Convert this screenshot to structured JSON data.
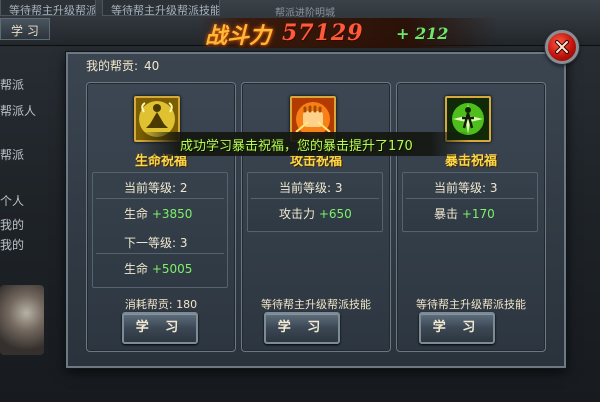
{
  "background": {
    "tabs": [
      "等待帮主升级帮派技能",
      "等待帮主升级帮派技能"
    ],
    "learn_label": "学 习",
    "top_hint": "帮派进阶明城",
    "side_lines": [
      "帮派",
      "帮派人",
      "帮派",
      "个人",
      "我的",
      "我的"
    ]
  },
  "power": {
    "label": "战斗力",
    "value": "57129",
    "delta": "+ 212"
  },
  "dialog": {
    "contribution_label": "我的帮贡:",
    "contribution_value": "40",
    "toast": "成功学习暴击祝福，您的暴击提升了170"
  },
  "skills": [
    {
      "name": "生命祝福",
      "icon": "meditation-icon",
      "current_level_label": "当前等级: 2",
      "current_stat_name": "生命",
      "current_stat_value": "+3850",
      "next_level_label": "下一等级: 3",
      "next_stat_name": "生命",
      "next_stat_value": "+5005",
      "cost_text": "消耗帮贡: 180",
      "button_label": "学 习"
    },
    {
      "name": "攻击祝福",
      "icon": "fist-icon",
      "current_level_label": "当前等级: 3",
      "current_stat_name": "攻击力",
      "current_stat_value": "+650",
      "cost_text": "等待帮主升级帮派技能",
      "button_label": "学 习"
    },
    {
      "name": "暴击祝福",
      "icon": "critical-burst-icon",
      "current_level_label": "当前等级: 3",
      "current_stat_name": "暴击",
      "current_stat_value": "+170",
      "cost_text": "等待帮主升级帮派技能",
      "button_label": "学 习"
    }
  ]
}
